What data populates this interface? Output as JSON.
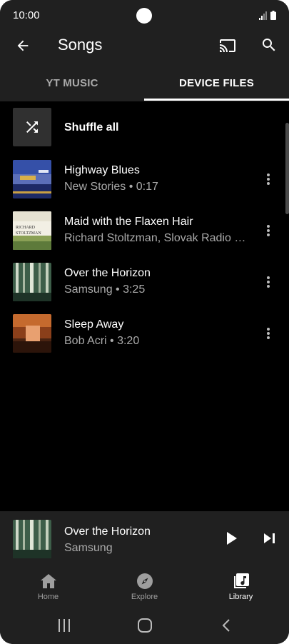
{
  "status_bar": {
    "time": "10:00"
  },
  "header": {
    "title": "Songs"
  },
  "tabs": [
    {
      "label": "YT MUSIC",
      "active": false
    },
    {
      "label": "DEVICE FILES",
      "active": true
    }
  ],
  "shuffle": {
    "label": "Shuffle all"
  },
  "songs": [
    {
      "title": "Highway Blues",
      "subtitle": "New Stories • 0:17",
      "art": "highway-blues-art"
    },
    {
      "title": "Maid with the Flaxen Hair",
      "subtitle": "Richard Stoltzman, Slovak Radio Sy...",
      "art": "maid-flaxen-hair-art",
      "art_text": "RICHARD STOLTZMAN"
    },
    {
      "title": "Over the Horizon",
      "subtitle": "Samsung • 3:25",
      "art": "over-the-horizon-art"
    },
    {
      "title": "Sleep Away",
      "subtitle": "Bob Acri • 3:20",
      "art": "sleep-away-art"
    }
  ],
  "mini_player": {
    "title": "Over the Horizon",
    "artist": "Samsung"
  },
  "bottom_nav": [
    {
      "label": "Home",
      "icon": "home-icon",
      "active": false
    },
    {
      "label": "Explore",
      "icon": "compass-icon",
      "active": false
    },
    {
      "label": "Library",
      "icon": "library-music-icon",
      "active": true
    }
  ],
  "colors": {
    "background": "#000000",
    "surface": "#202020",
    "text_primary": "#ffffff",
    "text_secondary": "#aaaaaa",
    "nav_inactive": "#9e9e9e"
  }
}
